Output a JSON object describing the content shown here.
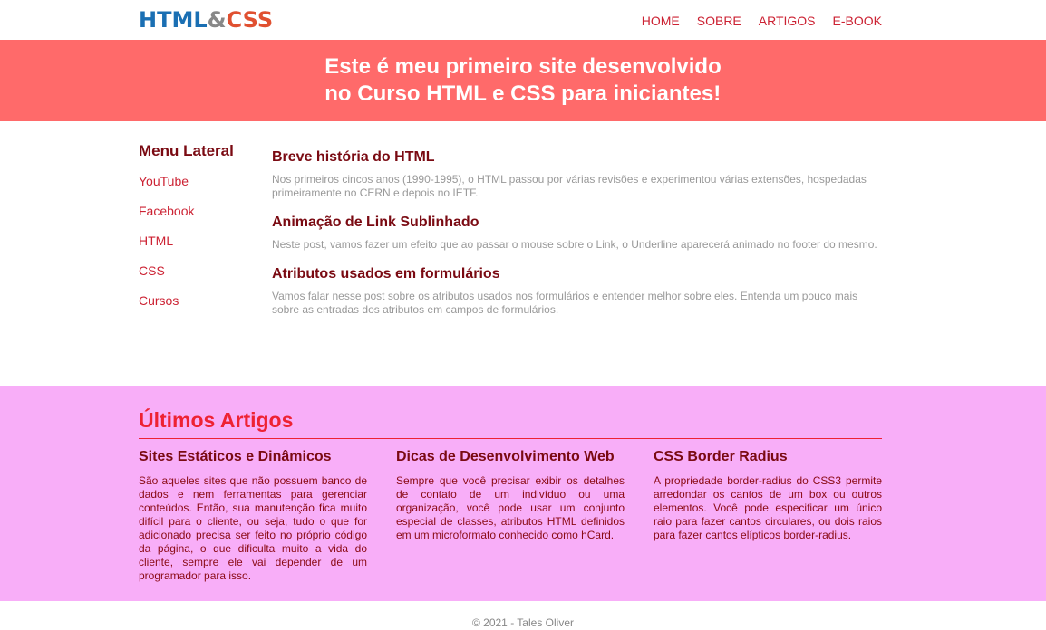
{
  "header": {
    "logo": {
      "part1": "HTML",
      "amp": "&",
      "part2": "CSS"
    },
    "nav": [
      {
        "label": "HOME"
      },
      {
        "label": "SOBRE"
      },
      {
        "label": "ARTIGOS"
      },
      {
        "label": "E-BOOK"
      }
    ]
  },
  "hero": {
    "line1": "Este é meu primeiro site desenvolvido",
    "line2": "no Curso HTML e CSS para iniciantes!"
  },
  "sidebar": {
    "title": "Menu Lateral",
    "items": [
      {
        "label": "YouTube"
      },
      {
        "label": "Facebook"
      },
      {
        "label": "HTML"
      },
      {
        "label": "CSS"
      },
      {
        "label": "Cursos"
      }
    ]
  },
  "posts": [
    {
      "title": "Breve história do HTML",
      "text": "Nos primeiros cincos anos (1990-1995), o HTML passou por várias revisões e experimentou várias extensões, hospedadas primeiramente no CERN e depois no IETF."
    },
    {
      "title": "Animação de Link Sublinhado",
      "text": "Neste post, vamos fazer um efeito que ao passar o mouse sobre o Link, o Underline aparecerá animado no footer do mesmo."
    },
    {
      "title": "Atributos usados em formulários",
      "text": "Vamos falar nesse post sobre os atributos usados nos formulários e entender melhor sobre eles. Entenda um pouco mais sobre as entradas dos atributos em campos de formulários."
    }
  ],
  "articles": {
    "title": "Últimos Artigos",
    "items": [
      {
        "title": "Sites Estáticos e Dinâmicos",
        "text": "São aqueles sites que não possuem banco de dados e nem ferramentas para gerenciar conteúdos. Então, sua manutenção fica muito difícil para o cliente, ou seja, tudo o que for adicionado precisa ser feito no próprio código da página, o que dificulta muito a vida do cliente, sempre ele vai depender de um programador para isso."
      },
      {
        "title": "Dicas de Desenvolvimento Web",
        "text": "Sempre que você precisar exibir os detalhes de contato de um indivíduo ou uma organização, você pode usar um conjunto especial de classes, atributos HTML definidos em um microformato conhecido como hCard."
      },
      {
        "title": "CSS Border Radius",
        "text": "A propriedade border-radius do CSS3 permite arredondar os cantos de um box ou outros elementos. Você pode especificar um único raio para fazer cantos circulares, ou dois raios para fazer cantos elípticos border-radius."
      }
    ]
  },
  "footer": {
    "text": "© 2021 - Tales Oliver"
  },
  "colors": {
    "hero_bg": "#ff6a6a",
    "articles_bg": "#f8aef8",
    "link": "#cc2233",
    "heading_dark": "#7a0a12",
    "section_title": "#ee2233"
  }
}
